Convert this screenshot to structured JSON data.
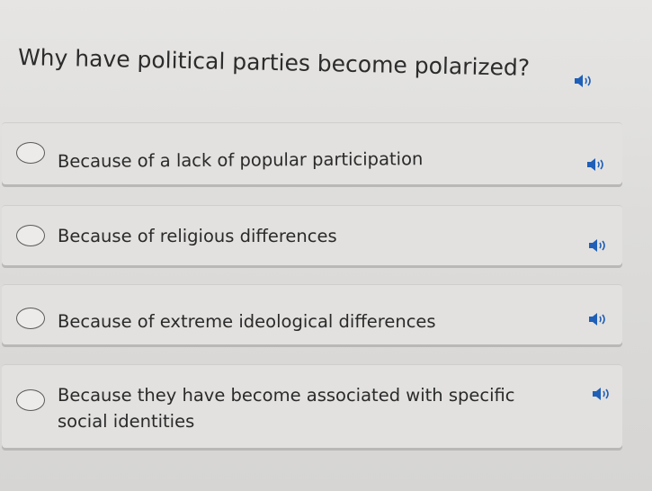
{
  "question": {
    "text": "Why have political parties become polarized?",
    "audio_icon": "speaker-icon"
  },
  "options": [
    {
      "label": "Because of a lack of popular participation",
      "selected": false,
      "audio_icon": "speaker-icon"
    },
    {
      "label": "Because of religious differences",
      "selected": false,
      "audio_icon": "speaker-icon"
    },
    {
      "label": "Because of extreme ideological differences",
      "selected": false,
      "audio_icon": "speaker-icon"
    },
    {
      "label": "Because they have become associated with specific social identities",
      "selected": false,
      "audio_icon": "speaker-icon"
    }
  ],
  "colors": {
    "background": "#dddcda",
    "option_bg": "#e2e1df",
    "text": "#2a2a2a",
    "radio_border": "#5a5a5a",
    "speaker_icon": "#1f5fb8"
  }
}
